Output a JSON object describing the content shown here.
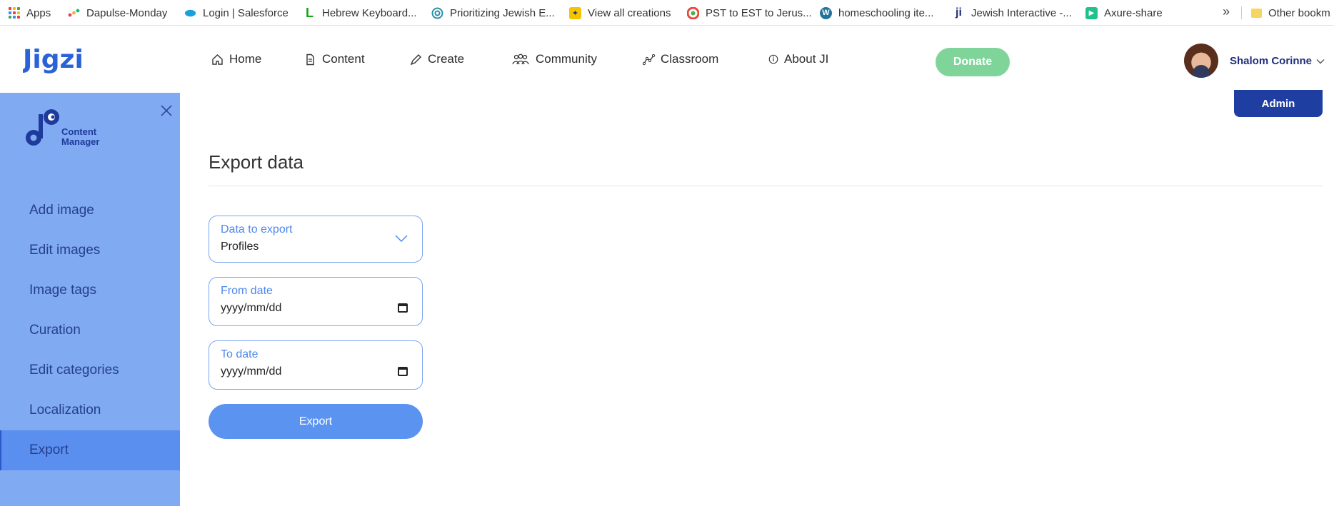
{
  "bookmarks": [
    {
      "label": "Apps",
      "icon": "apps-grid-icon"
    },
    {
      "label": "Dapulse-Monday",
      "icon": "monday-icon",
      "color": "#e2445c"
    },
    {
      "label": "Login | Salesforce",
      "icon": "salesforce-cloud-icon",
      "color": "#1aa0db"
    },
    {
      "label": "Hebrew Keyboard...",
      "icon": "letter-l-icon",
      "color": "#19a319"
    },
    {
      "label": "Prioritizing Jewish E...",
      "icon": "spiral-icon",
      "color": "#2a8fa8"
    },
    {
      "label": "View all creations",
      "icon": "creations-icon",
      "color": "#f4c400"
    },
    {
      "label": "PST to EST to Jerus...",
      "icon": "clock-wheel-icon",
      "color": "#e84a3c"
    },
    {
      "label": "homeschooling ite...",
      "icon": "wordpress-icon",
      "color": "#21759b"
    },
    {
      "label": "Jewish Interactive -...",
      "icon": "ji-icon",
      "color": "#1e2f7a"
    },
    {
      "label": "Axure-share",
      "icon": "play-icon",
      "color": "#1fc28b"
    }
  ],
  "bookmarks_overflow": "»",
  "other_bookmarks": "Other bookm",
  "header": {
    "logo_text": "Jigzi",
    "nav": [
      {
        "label": "Home",
        "icon": "home-icon"
      },
      {
        "label": "Content",
        "icon": "document-icon"
      },
      {
        "label": "Create",
        "icon": "pencil-icon"
      },
      {
        "label": "Community",
        "icon": "people-icon"
      },
      {
        "label": "Classroom",
        "icon": "graph-icon"
      },
      {
        "label": "About JI",
        "icon": "info-icon"
      }
    ],
    "donate_label": "Donate",
    "user_name": "Shalom Corinne",
    "admin_label": "Admin"
  },
  "sidebar": {
    "logo_text": [
      "Content",
      "Manager"
    ],
    "items": [
      {
        "label": "Add image"
      },
      {
        "label": "Edit images"
      },
      {
        "label": "Image tags"
      },
      {
        "label": "Curation"
      },
      {
        "label": "Edit categories"
      },
      {
        "label": "Localization"
      },
      {
        "label": "Export",
        "active": true
      }
    ]
  },
  "main": {
    "title": "Export data",
    "data_to_export": {
      "label": "Data to export",
      "value": "Profiles"
    },
    "from_date": {
      "label": "From date",
      "placeholder": "yyyy/mm/dd"
    },
    "to_date": {
      "label": "To date",
      "placeholder": "yyyy/mm/dd"
    },
    "export_label": "Export"
  },
  "colors": {
    "sidebar_bg": "#80aaf2",
    "sidebar_active": "#5a8ff0",
    "accent": "#5b93f1",
    "brand_dark": "#1e3ea2",
    "donate": "#7fd49a"
  }
}
